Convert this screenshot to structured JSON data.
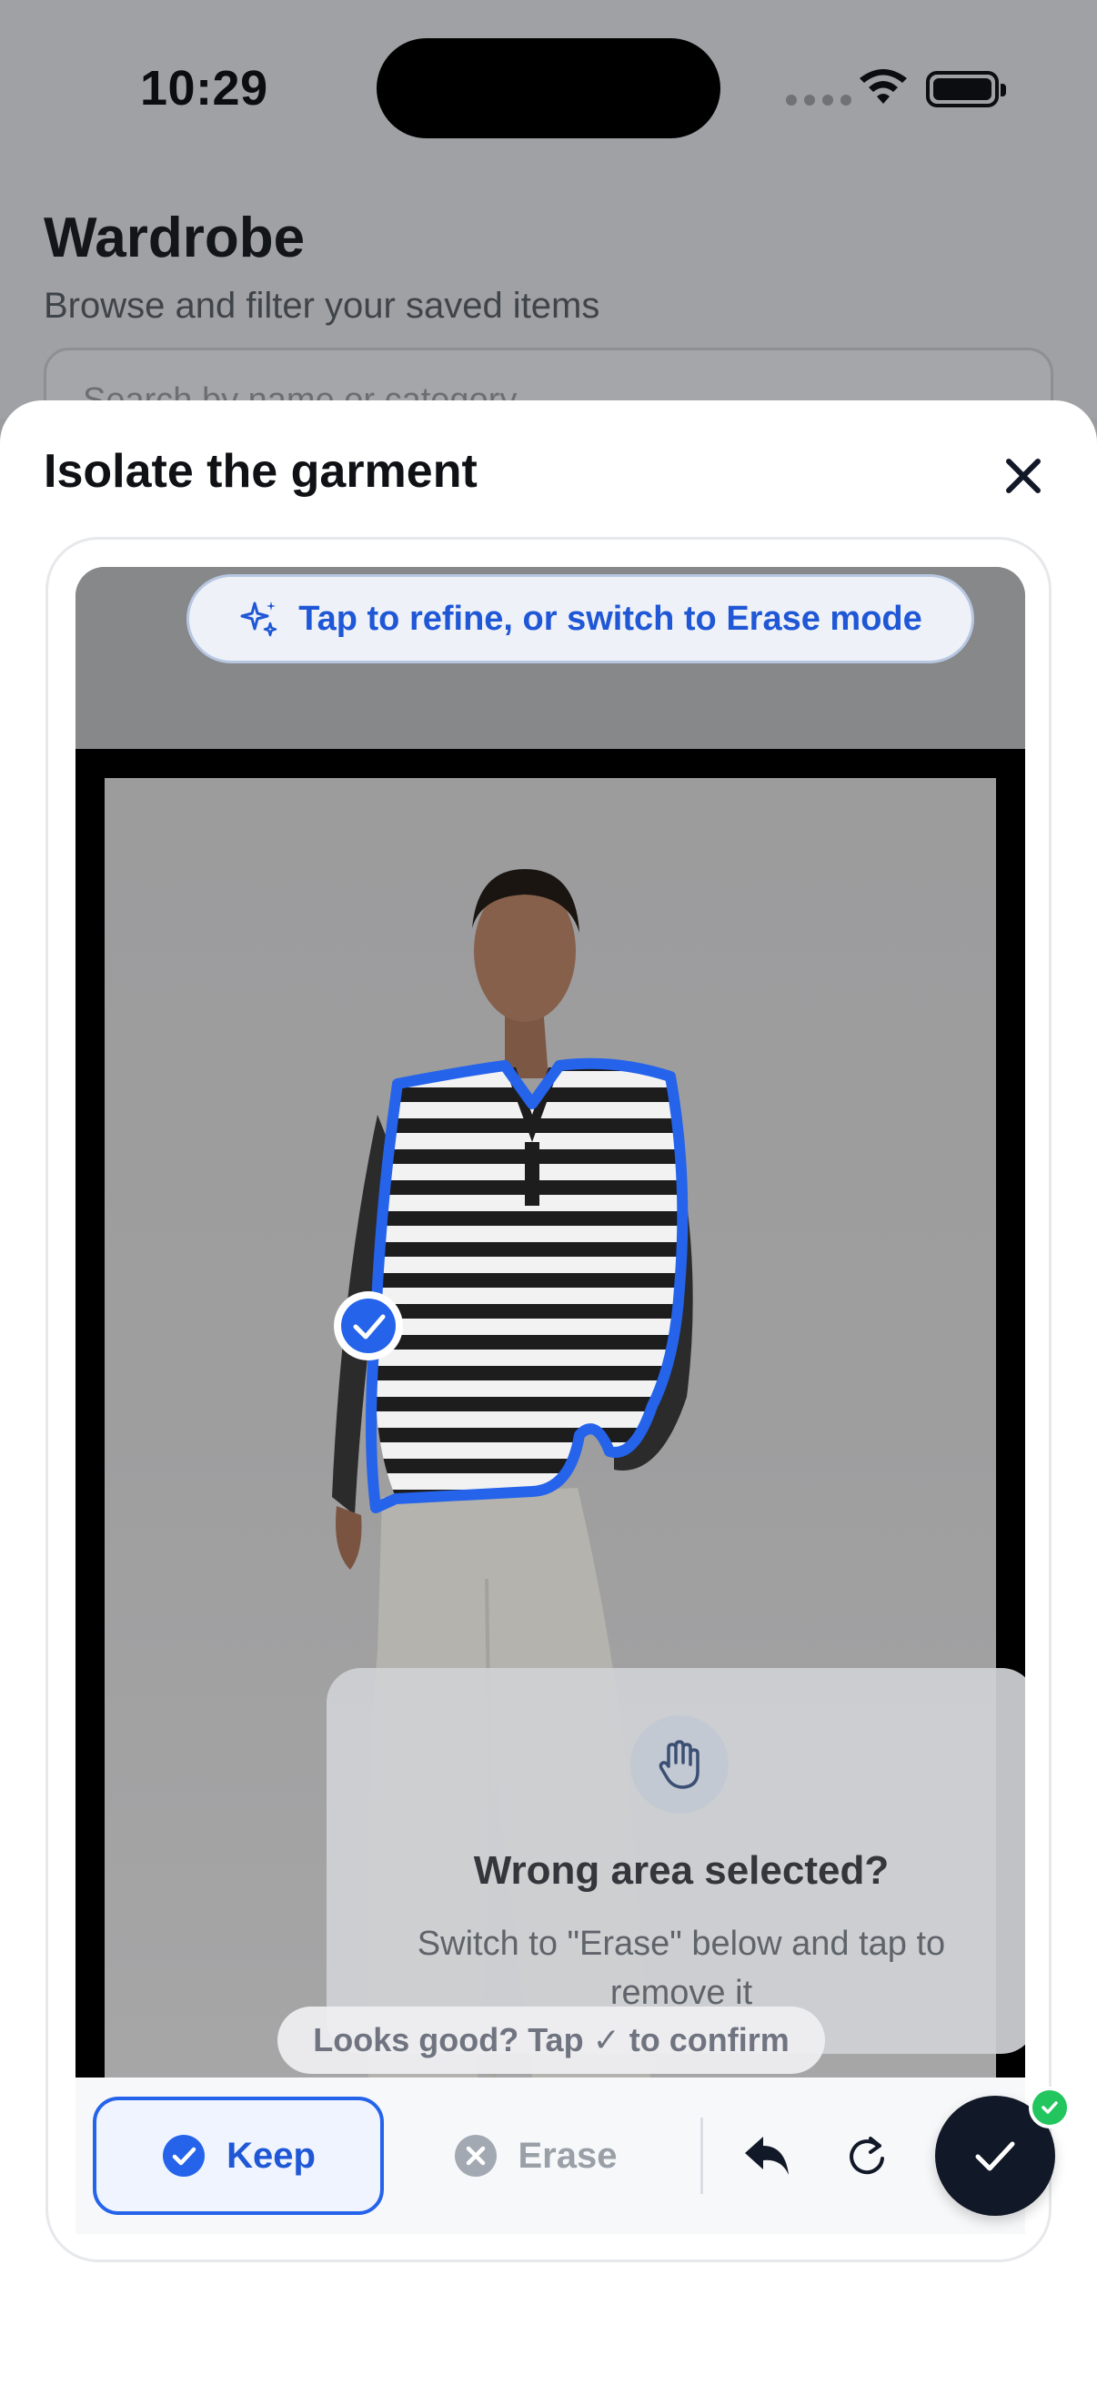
{
  "status_bar": {
    "time": "10:29"
  },
  "background_screen": {
    "title": "Wardrobe",
    "subtitle": "Browse and filter your saved items",
    "search_placeholder": "Search by name or category"
  },
  "sheet": {
    "title": "Isolate the garment",
    "hint": "Tap to refine, or switch to Erase mode",
    "toast_title": "Wrong area selected?",
    "toast_body": "Switch to \"Erase\" below and tap to remove it",
    "confirm_hint": "Looks good? Tap ✓ to confirm",
    "toolbar": {
      "keep_label": "Keep",
      "erase_label": "Erase",
      "active_mode": "Keep"
    }
  },
  "colors": {
    "accent": "#2563eb",
    "selection_outline": "#2563eb",
    "done_button": "#111827",
    "success": "#22c55e"
  },
  "icons": {
    "close": "close-icon",
    "sparkle": "sparkle-icon",
    "hand": "hand-icon",
    "keep": "check-circle-icon",
    "erase": "x-circle-icon",
    "undo": "undo-icon",
    "redo": "redo-icon",
    "done": "checkmark-icon"
  }
}
